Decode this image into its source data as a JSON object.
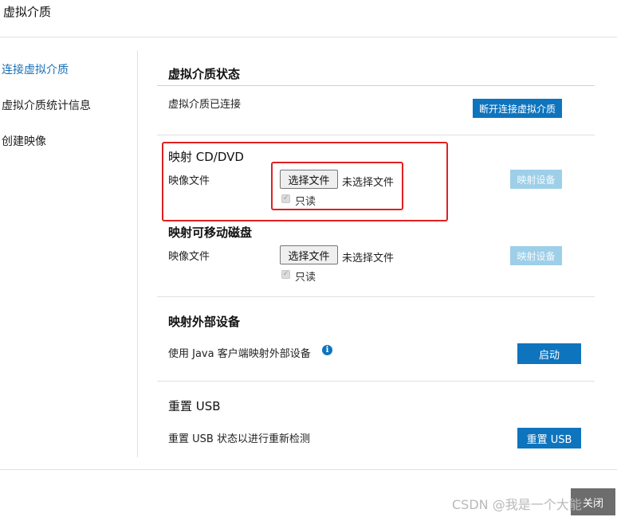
{
  "dialog": {
    "title": "虚拟介质"
  },
  "nav": {
    "items": [
      {
        "label": "连接虚拟介质",
        "active": true
      },
      {
        "label": "虚拟介质统计信息",
        "active": false
      },
      {
        "label": "创建映像",
        "active": false
      }
    ]
  },
  "status_section": {
    "title": "虚拟介质状态",
    "status_text": "虚拟介质已连接",
    "disconnect_label": "断开连接虚拟介质"
  },
  "cd_section": {
    "title": "映射 CD/DVD",
    "image_label": "映像文件",
    "choose_file_label": "选择文件",
    "no_file_text": "未选择文件",
    "readonly_label": "只读",
    "map_label": "映射设备"
  },
  "removable_section": {
    "title": "映射可移动磁盘",
    "image_label": "映像文件",
    "choose_file_label": "选择文件",
    "no_file_text": "未选择文件",
    "readonly_label": "只读",
    "map_label": "映射设备"
  },
  "external_section": {
    "title": "映射外部设备",
    "description": "使用 Java 客户端映射外部设备",
    "launch_label": "启动"
  },
  "usb_section": {
    "title": "重置 USB",
    "description": "重置 USB 状态以进行重新检测",
    "reset_label": "重置 USB"
  },
  "footer": {
    "watermark": "CSDN @我是一个大能",
    "close_label": "关闭"
  },
  "colors": {
    "accent": "#0f74be",
    "disabled_button": "#9ecfe8",
    "highlight_box": "#e02020",
    "nav_active": "#1b6fb3"
  }
}
